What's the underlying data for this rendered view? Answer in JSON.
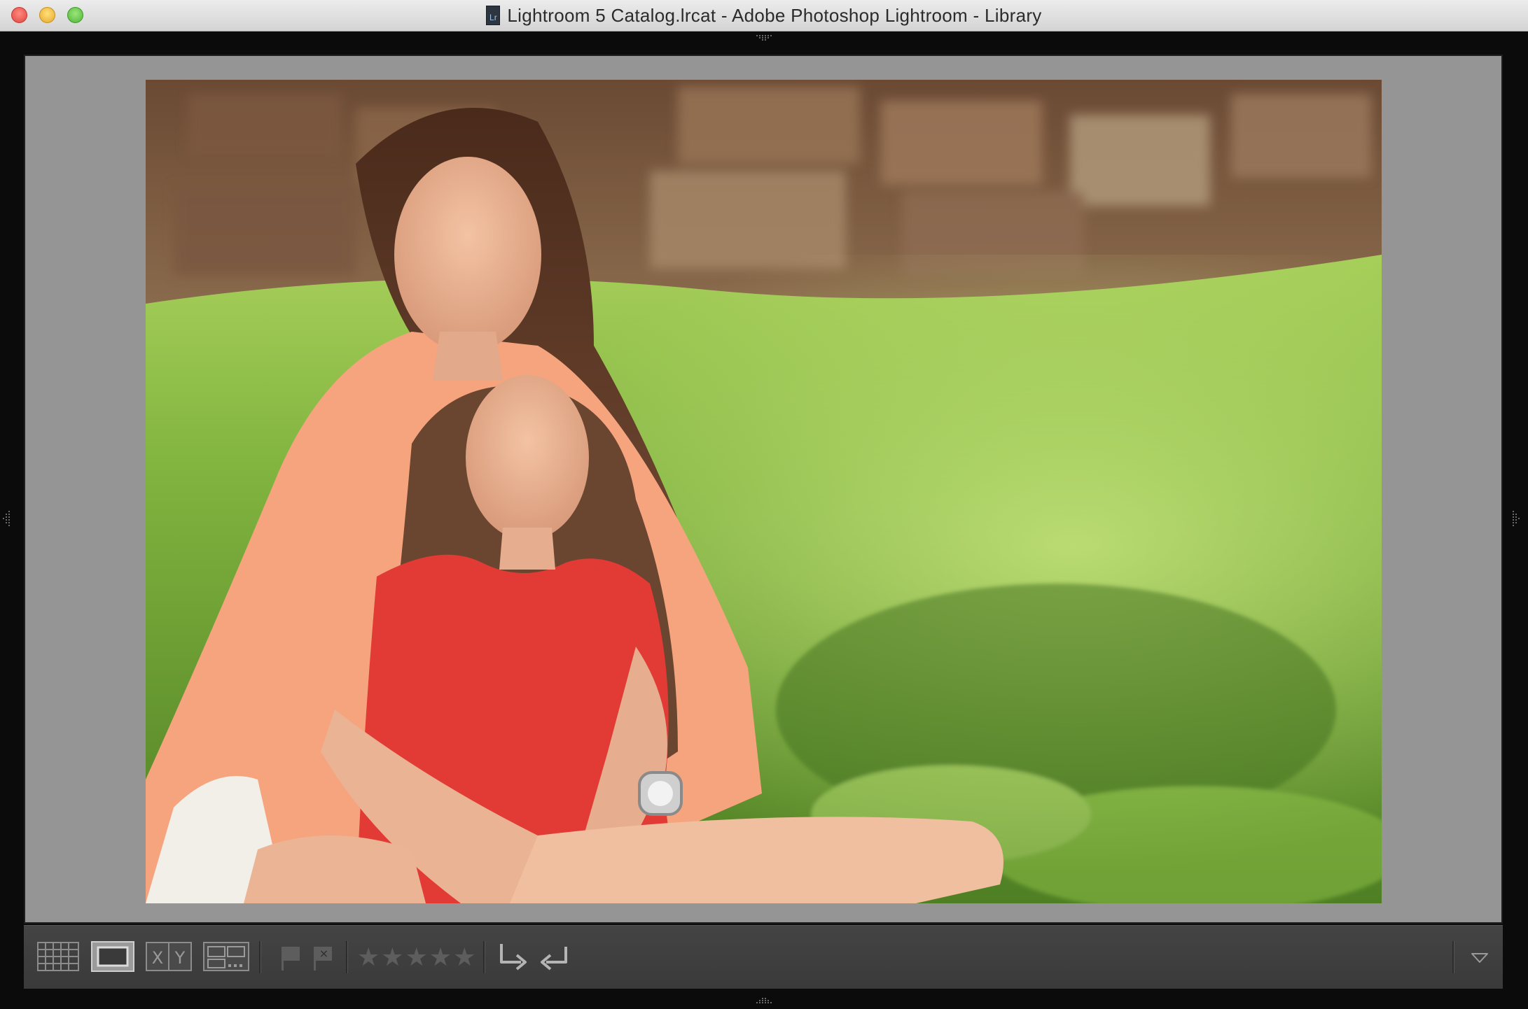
{
  "window": {
    "title": "Lightroom 5 Catalog.lrcat - Adobe Photoshop Lightroom - Library",
    "doc_icon_label": "Lr"
  },
  "colors": {
    "loupe_background": "#959595",
    "toolbar_background": "#3d3d3d",
    "icon_color": "#c8c8c8",
    "disabled_icon_color": "#5d5d5d"
  },
  "toolbar": {
    "view_modes": [
      "grid-view-icon",
      "loupe-view-icon",
      "compare-view-icon",
      "survey-view-icon"
    ],
    "active_view": "loupe",
    "compare_label_x": "X",
    "compare_label_y": "Y",
    "flags": [
      "pick-flag-icon",
      "reject-flag-icon"
    ],
    "reject_mark": "×",
    "rating_stars": [
      "★",
      "★",
      "★",
      "★",
      "★"
    ],
    "rating_value": 0,
    "rotate": [
      "rotate-left-icon",
      "rotate-right-icon"
    ],
    "dropdown_icon": "chevron-down-icon"
  },
  "photo": {
    "description_icon": "photo-image"
  }
}
